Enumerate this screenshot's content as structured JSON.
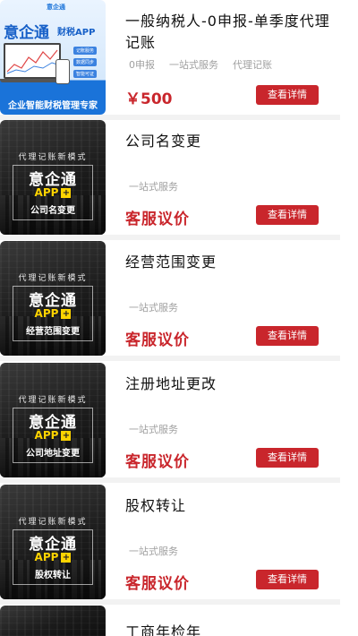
{
  "items": [
    {
      "title": "一般纳税人-0申报-单季度代理记账",
      "tags": [
        "0申报",
        "一站式服务",
        "代理记账"
      ],
      "price": "￥500",
      "button": "查看详情",
      "image": {
        "logo": "意企通",
        "brand": "意企通",
        "app": "财税APP",
        "chips": [
          "记账服务",
          "数据同步",
          "智能可证"
        ],
        "banner": "企业智能财税管理专家"
      }
    },
    {
      "title": "公司名变更",
      "tags": [
        "一站式服务"
      ],
      "price": "客服议价",
      "button": "查看详情",
      "image": {
        "tagline": "代理记账新模式",
        "brand": "意企通",
        "app": "APP",
        "plus": "+",
        "sub": "公司名变更"
      }
    },
    {
      "title": "经营范围变更",
      "tags": [
        "一站式服务"
      ],
      "price": "客服议价",
      "button": "查看详情",
      "image": {
        "tagline": "代理记账新模式",
        "brand": "意企通",
        "app": "APP",
        "plus": "+",
        "sub": "经营范围变更"
      }
    },
    {
      "title": "注册地址更改",
      "tags": [
        "一站式服务"
      ],
      "price": "客服议价",
      "button": "查看详情",
      "image": {
        "tagline": "代理记账新模式",
        "brand": "意企通",
        "app": "APP",
        "plus": "+",
        "sub": "公司地址变更"
      }
    },
    {
      "title": "股权转让",
      "tags": [
        "一站式服务"
      ],
      "price": "客服议价",
      "button": "查看详情",
      "image": {
        "tagline": "代理记账新模式",
        "brand": "意企通",
        "app": "APP",
        "plus": "+",
        "sub": "股权转让"
      }
    }
  ],
  "partial_next": {
    "title": "工商年检年"
  },
  "colors": {
    "accent": "#c9262c",
    "tag": "#a0a0a0",
    "separator": "#f2f2f2"
  }
}
